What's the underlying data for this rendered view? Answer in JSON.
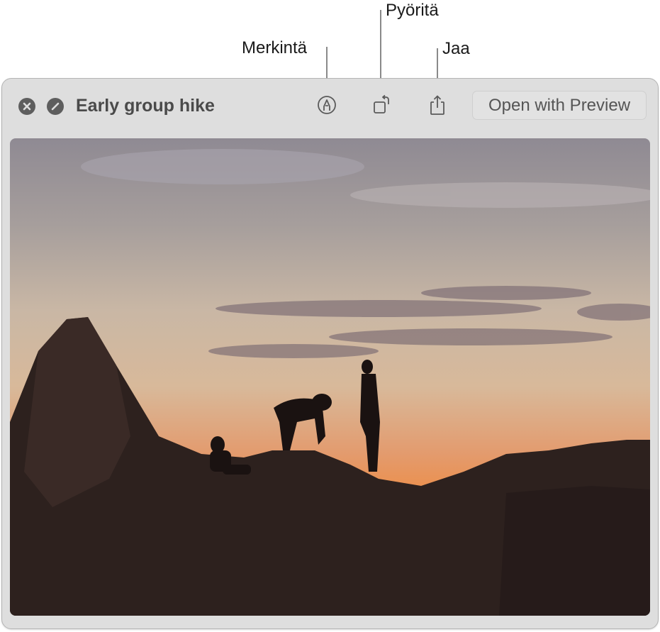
{
  "callouts": {
    "markup": "Merkintä",
    "rotate": "Pyöritä",
    "share": "Jaa"
  },
  "window": {
    "title": "Early group hike",
    "controls": [
      {
        "name": "close",
        "icon": "close-circle-icon"
      },
      {
        "name": "fullscreen",
        "icon": "slash-circle-icon"
      }
    ],
    "toolbar": {
      "markup_icon": "markup-pen-icon",
      "rotate_icon": "rotate-left-icon",
      "share_icon": "share-icon",
      "open_button_label": "Open with Preview"
    }
  },
  "photo": {
    "description": "Silhouettes of hikers on rocks at sunset"
  }
}
